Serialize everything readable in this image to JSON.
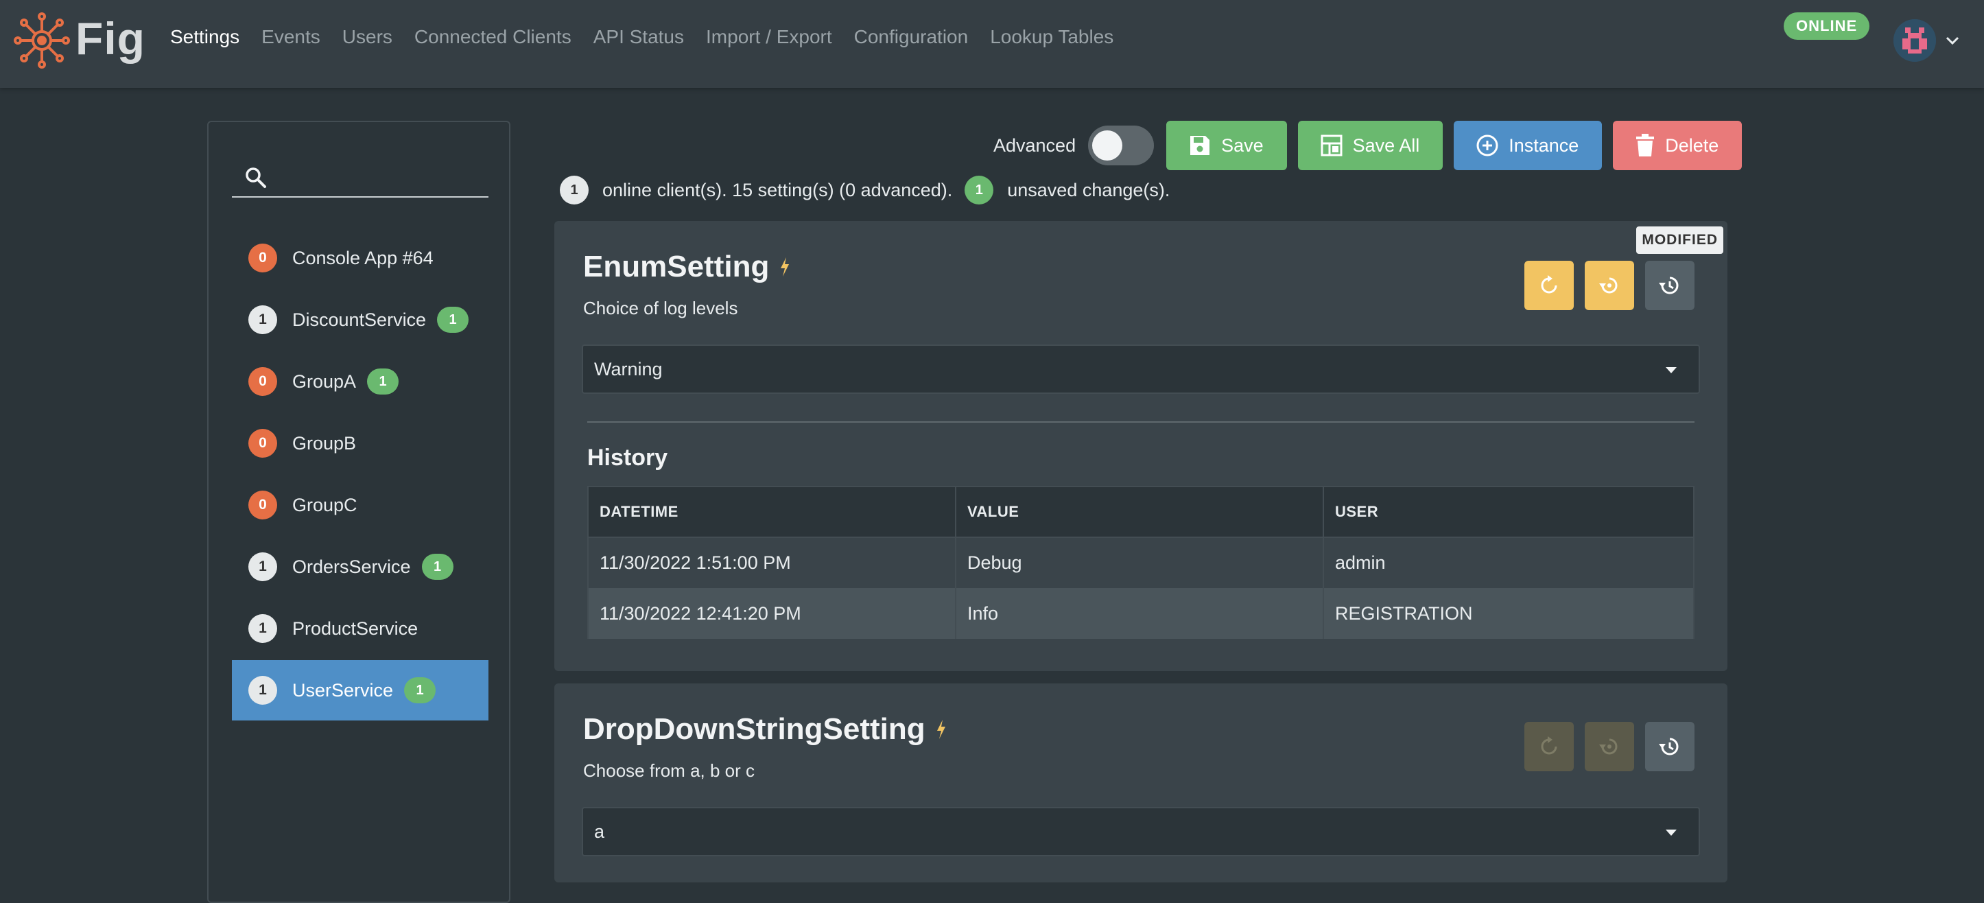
{
  "app": {
    "brand": "Fig",
    "status": "ONLINE"
  },
  "nav": [
    {
      "label": "Settings",
      "active": true
    },
    {
      "label": "Events"
    },
    {
      "label": "Users"
    },
    {
      "label": "Connected Clients"
    },
    {
      "label": "API Status"
    },
    {
      "label": "Import / Export"
    },
    {
      "label": "Configuration"
    },
    {
      "label": "Lookup Tables"
    }
  ],
  "search": {
    "placeholder": "",
    "value": ""
  },
  "clients": [
    {
      "count": "0",
      "name": "Console App #64",
      "changes": ""
    },
    {
      "count": "1",
      "name": "DiscountService",
      "changes": "1"
    },
    {
      "count": "0",
      "name": "GroupA",
      "changes": "1"
    },
    {
      "count": "0",
      "name": "GroupB",
      "changes": ""
    },
    {
      "count": "0",
      "name": "GroupC",
      "changes": ""
    },
    {
      "count": "1",
      "name": "OrdersService",
      "changes": "1"
    },
    {
      "count": "1",
      "name": "ProductService",
      "changes": ""
    },
    {
      "count": "1",
      "name": "UserService",
      "changes": "1",
      "selected": true
    }
  ],
  "toolbar": {
    "advanced_label": "Advanced",
    "save": "Save",
    "save_all": "Save All",
    "instance": "Instance",
    "delete": "Delete"
  },
  "status": {
    "online_count": "1",
    "online_text": "online client(s). 15 setting(s) (0 advanced).",
    "unsaved_count": "1",
    "unsaved_text": "unsaved change(s)."
  },
  "settings": [
    {
      "name": "EnumSetting",
      "description": "Choice of log levels",
      "value": "Warning",
      "badge": "MODIFIED",
      "history_title": "History",
      "history_columns": [
        "DATETIME",
        "VALUE",
        "USER"
      ],
      "history_rows": [
        [
          "11/30/2022 1:51:00 PM",
          "Debug",
          "admin"
        ],
        [
          "11/30/2022 12:41:20 PM",
          "Info",
          "REGISTRATION"
        ]
      ]
    },
    {
      "name": "DropDownStringSetting",
      "description": "Choose from a, b or c",
      "value": "a"
    }
  ],
  "colors": {
    "accent": "#4f8fc7",
    "success": "#6ab96f",
    "danger": "#e97a7a",
    "warning": "#f2c462",
    "orange": "#e66f45"
  }
}
